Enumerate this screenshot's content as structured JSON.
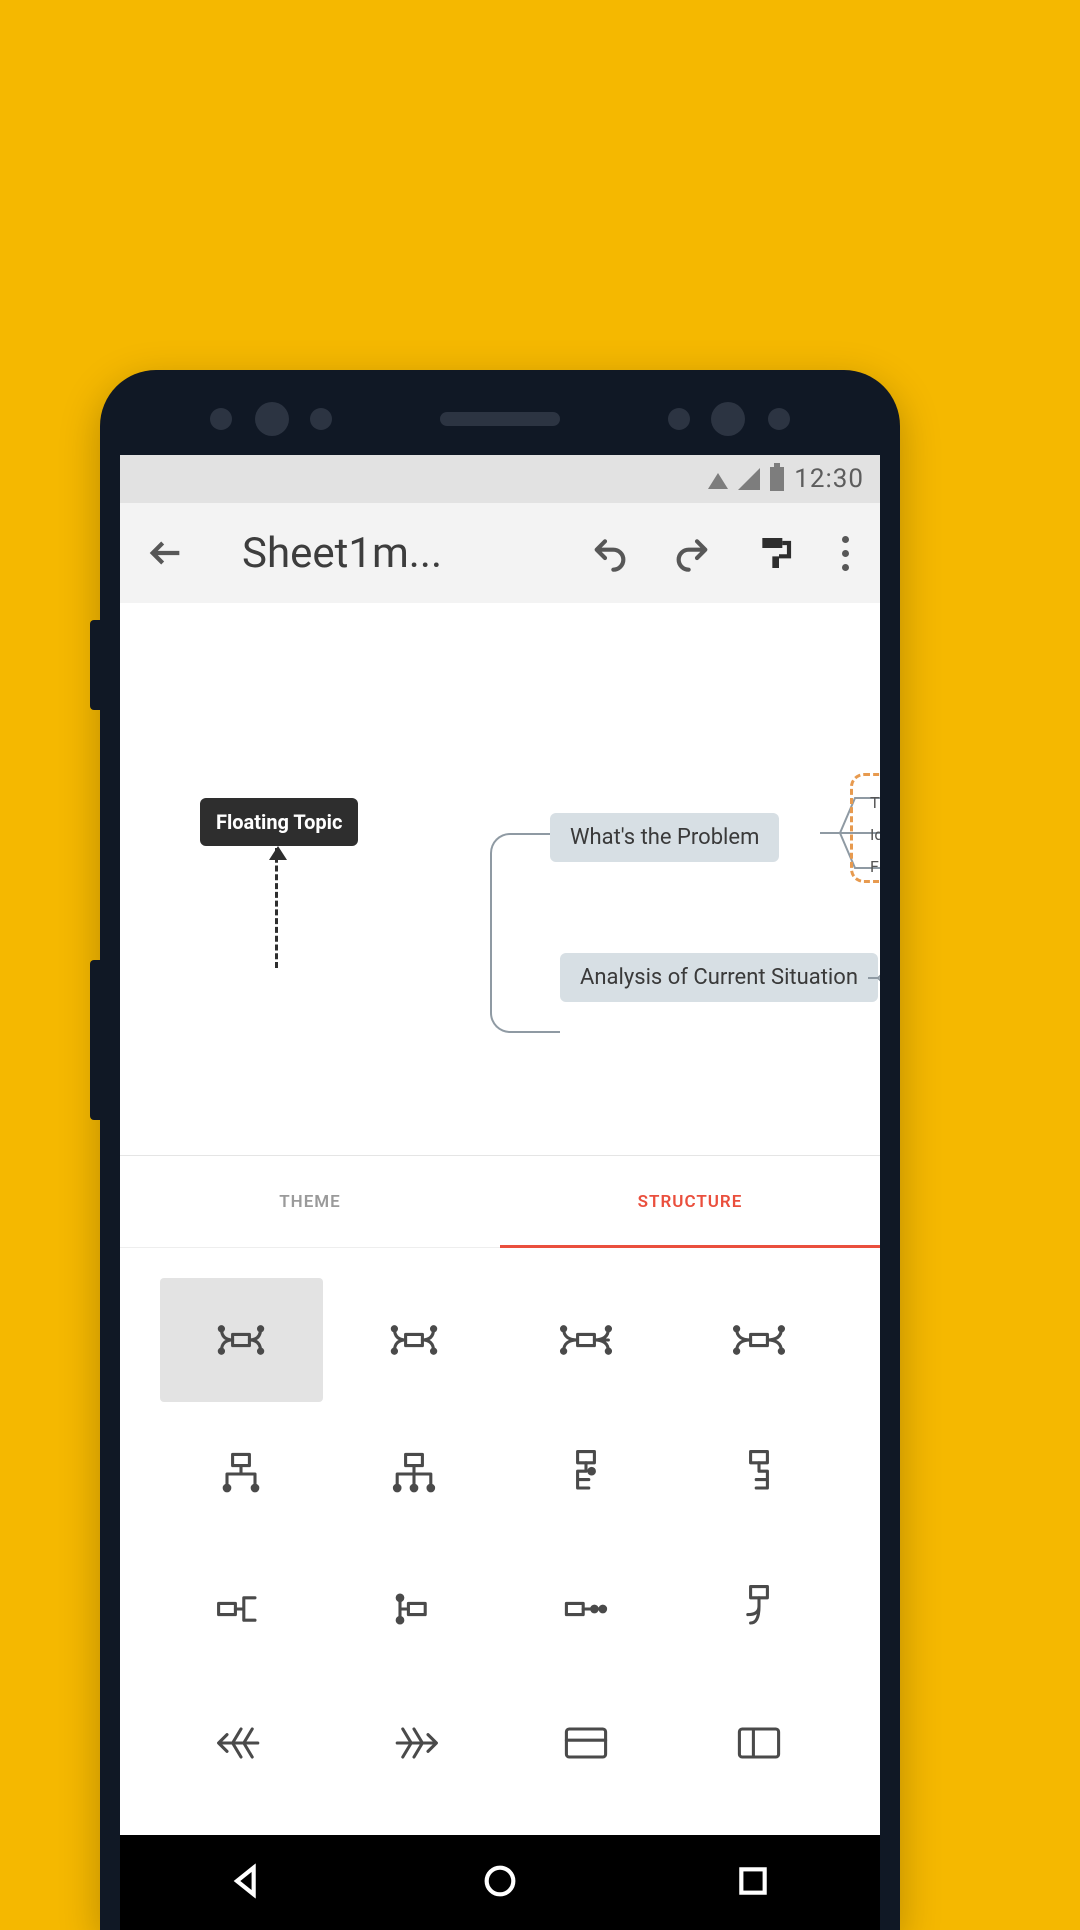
{
  "status": {
    "clock": "12:30"
  },
  "toolbar": {
    "title": "Sheet1m..."
  },
  "canvas": {
    "floating_topic": "Floating Topic",
    "node1": "What's the Problem",
    "node2": "Analysis of Current Situation",
    "sub1": "Th",
    "sub2": "Ide",
    "sub3": "Fir"
  },
  "panel": {
    "tab_theme": "THEME",
    "tab_structure": "STRUCTURE"
  }
}
